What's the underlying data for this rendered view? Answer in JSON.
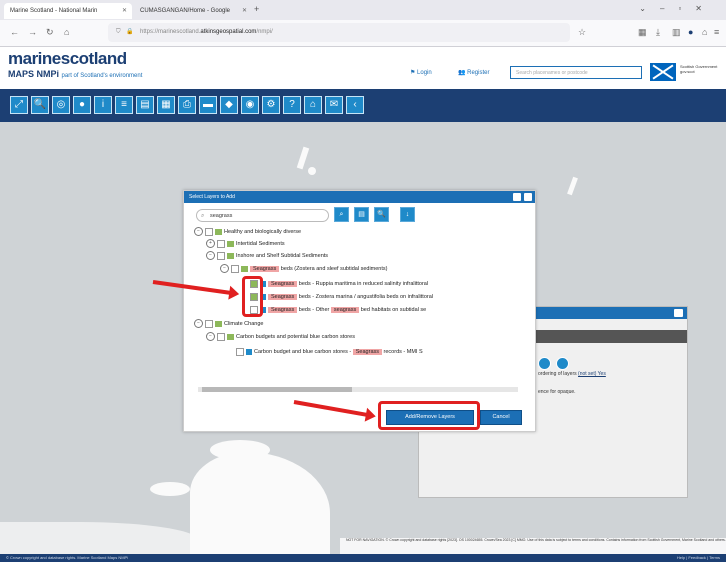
{
  "browser": {
    "tabs": [
      {
        "label": "Marine Scotland - National Marin",
        "active": true
      },
      {
        "label": "CUMASGANGAN/Home - Google",
        "active": false
      }
    ],
    "url_prefix": "https://marinescotland.",
    "url_domain": "atkinsgeospatial.com",
    "url_suffix": "/nmpi/"
  },
  "site": {
    "logo_line1_a": "marine",
    "logo_line1_b": "scotland",
    "logo_line2": "MAPS NMPi",
    "logo_tag": "part of Scotland's environment",
    "login": "Login",
    "register": "Register",
    "search_placeholder": "Search placenames or postcode",
    "gov_text": "Scottish Government gov.scot"
  },
  "dialog": {
    "title": "Select Layers to Add",
    "search_value": "seagrass",
    "tree": {
      "healthy": "Healthy and biologically diverse",
      "intertidal": "Intertidal Sediments",
      "inshore": "Inshore and Shelf Subtidal Sediments",
      "group_hl": "Seagrass",
      "group_rest": "beds (Zostera and sleef subtidal sediments)",
      "item1_hl": "Seagrass",
      "item1_rest": "beds - Ruppia maritima in reduced salinity infralittoral",
      "item2_hl": "Seagrass",
      "item2_rest": "beds - Zostera marina / angustifolia beds on infralittoral",
      "item3_hl": "Seagrass",
      "item3_mid": "beds - Other",
      "item3_hl2": "seagrass",
      "item3_rest": "bed habitats on subtidal se",
      "climate": "Climate Change",
      "carbon": "Carbon budgets and potential blue carbon stores",
      "carbon_item_a": "Carbon budget and blue carbon stores -",
      "carbon_item_hl": "Seagrass",
      "carbon_item_b": "records - MMI S"
    },
    "add_button": "Add/Remove Layers",
    "cancel_button": "Cancel"
  },
  "bg_dialog": {
    "text1": "ordering of layers",
    "text1_link": "(not set) Yes",
    "text2": "ence for opaque."
  },
  "map": {
    "copyright": "NOT FOR NAVIGATION. © Crown copyright and database rights [2023]. OS 100024655. Crown/Sea 2023 [C] MMO. Use of this data is subject to terms and conditions. Contains information from Scottish Government, Marine Scotland and others.",
    "status_left": "© Crown copyright and database rights. Marine Scotland Maps NMPi",
    "status_right": "Help | Feedback | Terms"
  }
}
